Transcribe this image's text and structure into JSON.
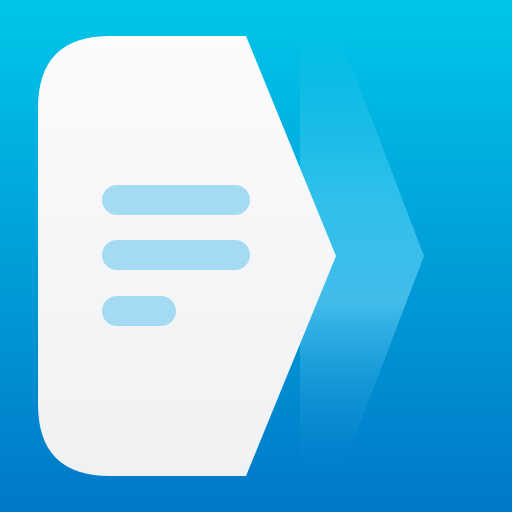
{
  "app_icon": {
    "icon_name": "document-arrow-icon",
    "colors": {
      "background_top": "#00c6ea",
      "background_bottom": "#0078c8",
      "shadow_chevron": "#35c6ea",
      "document_white": "#f7f8f9",
      "text_lines": "#a4dbf2"
    },
    "text_lines_count": 3
  }
}
